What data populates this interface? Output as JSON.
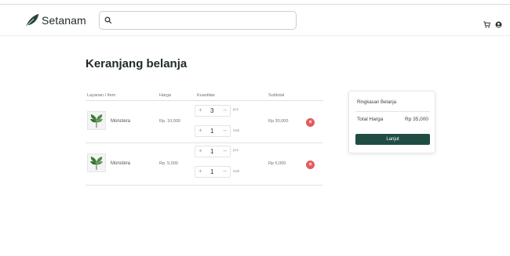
{
  "header": {
    "brand": "Setanam",
    "search": {
      "placeholder": "",
      "value": ""
    },
    "icons": [
      "cart-icon",
      "user-icon"
    ]
  },
  "page": {
    "title": "Keranjang belanja"
  },
  "cart": {
    "columns": {
      "item": "Layanan / Item",
      "price": "Harga",
      "qty": "Kuantitas",
      "subtotal": "Subtotal"
    },
    "rows": [
      {
        "name": "Monstera",
        "price": "Rp. 10,000",
        "qty_pcs": "3",
        "unit_pcs": "pcs",
        "qty_days": "1",
        "unit_days": "Hari",
        "subtotal": "Rp 30,000"
      },
      {
        "name": "Monstera",
        "price": "Rp. 5,000",
        "qty_pcs": "1",
        "unit_pcs": "pcs",
        "qty_days": "1",
        "unit_days": "Hari",
        "subtotal": "Rp 5,000"
      }
    ],
    "controls": {
      "plus": "+",
      "minus": "–",
      "remove": "×"
    }
  },
  "summary": {
    "title": "Ringkasan Belanja",
    "total_label": "Total Harga",
    "total_value": "Rp 35,000",
    "button": "Lanjut"
  },
  "colors": {
    "primary": "#1f4d43",
    "danger": "#e25c5c"
  }
}
